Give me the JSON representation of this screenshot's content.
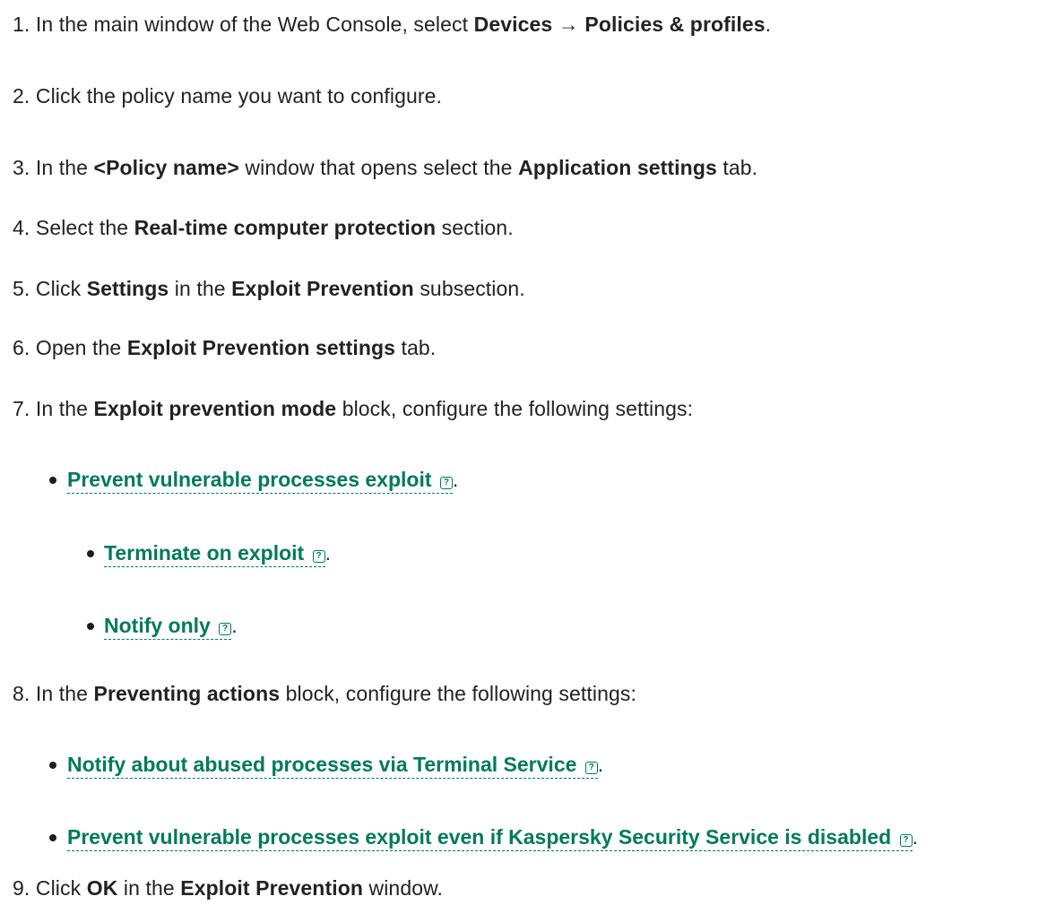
{
  "steps": [
    {
      "num": "1.",
      "parts": [
        "In the main window of the Web Console, select ",
        "Devices",
        " → ",
        "Policies & profiles",
        "."
      ]
    },
    {
      "num": "2.",
      "parts": [
        "Click the policy name you want to configure."
      ]
    },
    {
      "num": "3.",
      "parts": [
        "In the ",
        "<Policy name>",
        " window that opens select the ",
        "Application settings",
        " tab."
      ]
    },
    {
      "num": "4.",
      "parts": [
        "Select the ",
        "Real-time computer protection",
        " section."
      ]
    },
    {
      "num": "5.",
      "parts": [
        "Click ",
        "Settings",
        " in the ",
        "Exploit Prevention",
        " subsection."
      ]
    },
    {
      "num": "6.",
      "parts": [
        "Open the ",
        "Exploit Prevention settings",
        " tab."
      ]
    },
    {
      "num": "7.",
      "parts": [
        "In the ",
        "Exploit prevention mode",
        " block, configure the following settings:"
      ]
    },
    {
      "num": "8.",
      "parts": [
        "In the ",
        "Preventing actions",
        " block, configure the following settings:"
      ]
    },
    {
      "num": "9.",
      "parts": [
        "Click ",
        "OK",
        " in the ",
        "Exploit Prevention",
        " window."
      ]
    }
  ],
  "links": {
    "prevent_exploit": "Prevent vulnerable processes exploit",
    "terminate_on_exploit": "Terminate on exploit",
    "notify_only": "Notify only",
    "notify_terminal": "Notify about abused processes via Terminal Service",
    "prevent_even_disabled": "Prevent vulnerable processes exploit even if Kaspersky Security Service is disabled"
  },
  "help_glyph": "?",
  "period": ".",
  "colors": {
    "link": "#00795c",
    "text": "#222222"
  }
}
